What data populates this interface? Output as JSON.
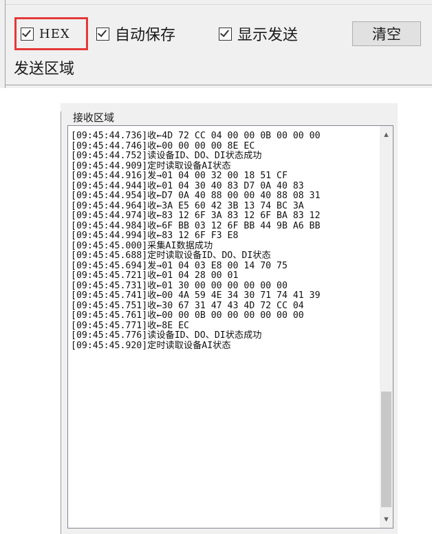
{
  "send_options": {
    "hex_label": "HEX",
    "auto_save_label": "自动保存",
    "show_send_label": "显示发送",
    "clear_button_label": "清空",
    "send_area_label": "发送区域",
    "highlight_color": "#e53838"
  },
  "receive_area": {
    "label": "接收区域",
    "log_lines": [
      "[09:45:44.736]收←4D 72 CC 04 00 00 0B 00 00 00",
      "[09:45:44.746]收←00 00 00 00 8E EC",
      "[09:45:44.752]读设备ID、DO、DI状态成功",
      "[09:45:44.909]定时读取设备AI状态",
      "[09:45:44.916]发→01 04 00 32 00 18 51 CF",
      "[09:45:44.944]收←01 04 30 40 83 D7 0A 40 83",
      "[09:45:44.954]收←D7 0A 40 88 00 00 40 88 08 31",
      "[09:45:44.964]收←3A E5 60 42 3B 13 74 BC 3A",
      "[09:45:44.974]收←83 12 6F 3A 83 12 6F BA 83 12",
      "[09:45:44.984]收←6F BB 03 12 6F BB 44 9B A6 BB",
      "[09:45:44.994]收←83 12 6F F3 E8",
      "[09:45:45.000]采集AI数据成功",
      "[09:45:45.688]定时读取设备ID、DO、DI状态",
      "[09:45:45.694]发→01 04 03 E8 00 14 70 75",
      "[09:45:45.721]收←01 04 28 00 01",
      "[09:45:45.731]收←01 30 00 00 00 00 00 00",
      "[09:45:45.741]收←00 4A 59 4E 34 30 71 74 41 39",
      "[09:45:45.751]收←30 67 31 47 43 4D 72 CC 04",
      "[09:45:45.761]收←00 00 0B 00 00 00 00 00 00",
      "[09:45:45.771]收←8E EC",
      "[09:45:45.776]读设备ID、DO、DI状态成功",
      "[09:45:45.920]定时读取设备AI状态"
    ],
    "scroll_up_icon": "▲",
    "scroll_down_icon": "▼"
  }
}
